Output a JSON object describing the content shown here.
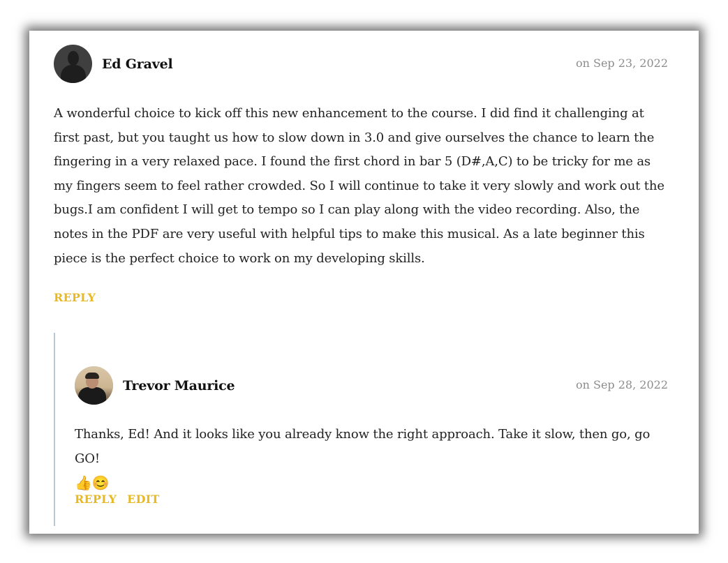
{
  "comments": [
    {
      "author": "Ed Gravel",
      "date": "on Sep 23, 2022",
      "avatar_icon": "default-user-silhouette",
      "text": "A wonderful choice to kick off this new enhancement to the course. I did find it challenging at first past, but you taught us how to slow down in 3.0 and give ourselves the chance to learn the fingering in a very relaxed pace. I found the first chord in bar 5 (D#,A,C) to be tricky for me as my fingers seem to feel rather crowded. So I will continue to take it very slowly and work out the bugs.I am confident I will get to tempo so I can play along with the video recording. Also, the notes in the PDF are very useful with helpful tips to make this musical. As a late beginner this piece is the perfect choice to work on my developing skills.",
      "reply_label": "REPLY"
    },
    {
      "author": "Trevor Maurice",
      "date": "on Sep 28, 2022",
      "avatar_icon": "user-photo",
      "text": "Thanks, Ed! And it looks like you already know the right approach. Take it slow, then go, go GO!",
      "emoji": "👍😊",
      "reply_label": "REPLY",
      "edit_label": "EDIT"
    }
  ],
  "colors": {
    "accent": "#e8b923",
    "date": "#8c8c8c",
    "thread_line": "#b9c7d3"
  }
}
